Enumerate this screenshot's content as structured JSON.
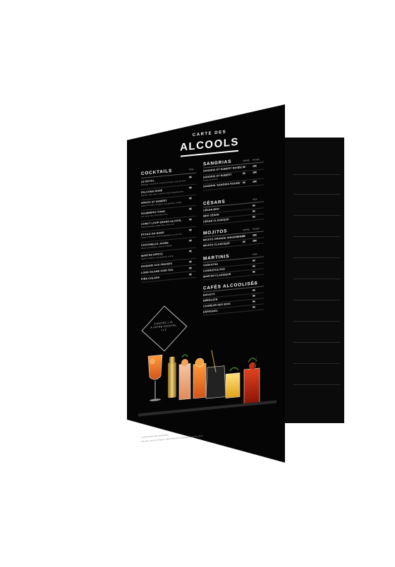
{
  "menu": {
    "title_small": "CARTE DES",
    "title_big": "ALCOOLS",
    "badge_text": [
      "AJOUTEZ 1 CL",
      "À VOTRE COCKTAIL",
      "+1 €"
    ],
    "cocktails": {
      "title": "COCKTAILS",
      "col": "PRIX",
      "items": [
        {
          "name": "LE ROYAL",
          "desc": "Mélange, concombre, Crémant d'Alsace, sirop de citron",
          "price": "9€"
        },
        {
          "name": "FALCONA ROSÉ",
          "desc": "Bacardi, rose, citron, Crémant, sirop Pamplemousse",
          "price": "9€"
        },
        {
          "name": "SPRITZ ST HUBERT",
          "desc": "Aperol St Hubert, Prosecco, eau gazeuse, orange",
          "price": "9€"
        },
        {
          "name": "SCHWEPPS TONIC",
          "desc": "Gin, citron vert, concombre, tonic",
          "price": "9€"
        },
        {
          "name": "CONCT LOOP EBANO ALCOOL",
          "desc": "Sirop de passion, ginger beer, citron vert",
          "price": "9€"
        },
        {
          "name": "ÉTOILE DU NORD",
          "desc": "Vodka, Cointreau, sirop de grenadine, jus de citron",
          "price": "9€"
        },
        {
          "name": "COCCINELLE JAUNE",
          "desc": "Rhum, jus d'ananas, sirop de mangue",
          "price": "9€"
        },
        {
          "name": "MARTINI SPRITZ",
          "desc": "Martini, Prosecco, eau gazeuse, orange",
          "price": "9€"
        },
        {
          "name": "DAIQUIRI AUX FRAISES",
          "desc": "",
          "price": "9€"
        },
        {
          "name": "LONG ISLAND ICED TEA",
          "desc": "",
          "price": "9€"
        },
        {
          "name": "PIÑA COLADA",
          "desc": "",
          "price": "9€"
        }
      ]
    },
    "sangrias": {
      "title": "SANGRIAS",
      "cols": [
        "VERRE",
        "PICHET"
      ],
      "items": [
        {
          "name": "SANGRIA ST HUBERT ROSÉE",
          "p1": "5€",
          "p2": "19€"
        },
        {
          "name": "SANGRIA ST HUBERT",
          "sub": "Rouge ou blanche",
          "p1": "5€",
          "p2": "19€"
        },
        {
          "name": "SANGRIA 'SANGRIA ROUGE'",
          "p1": "5€",
          "p2": "19€"
        }
      ]
    },
    "cesars": {
      "title": "CÉSARS",
      "col": "PRIX",
      "items": [
        {
          "name": "CÉSAR BRO",
          "price": "9€"
        },
        {
          "name": "MINI CÉSAR",
          "price": "9€"
        },
        {
          "name": "CÉSAR CLASSIQUE",
          "price": "9€"
        }
      ]
    },
    "mojitos": {
      "title": "MOJITOS",
      "cols": [
        "VERRE",
        "PICHET"
      ],
      "items": [
        {
          "name": "MOJITO ORANGE GINGEMBRE",
          "p1": "9€",
          "p2": "39€"
        },
        {
          "name": "MOJITO CLASSIQUE",
          "p1": "9€",
          "p2": "39€"
        }
      ]
    },
    "martinis": {
      "title": "MARTINIS",
      "col": "PRIX",
      "items": [
        {
          "name": "VODKATINI",
          "price": "9€"
        },
        {
          "name": "COSMOPOLITAN",
          "price": "9€"
        },
        {
          "name": "MARTINI CLASSIQUE",
          "price": "9€"
        }
      ]
    },
    "cafes": {
      "title": "CAFÉS ALCOOLISÉS",
      "col": "PRIX",
      "items": [
        {
          "name": "BAILEYS",
          "price": "9€"
        },
        {
          "name": "BRÉSILIEN",
          "price": "9€"
        },
        {
          "name": "COUREUR DES BOIS",
          "price": "9€"
        },
        {
          "name": "ESPAGNOL",
          "price": "9€"
        }
      ]
    },
    "footer": [
      "À consommer avec modération",
      "Prix nets, service compris. L'abus d'alcool est dangereux pour la santé."
    ]
  },
  "colors": {
    "background": "#ffffff",
    "cover": "#050505",
    "accent": "#e0542a"
  }
}
